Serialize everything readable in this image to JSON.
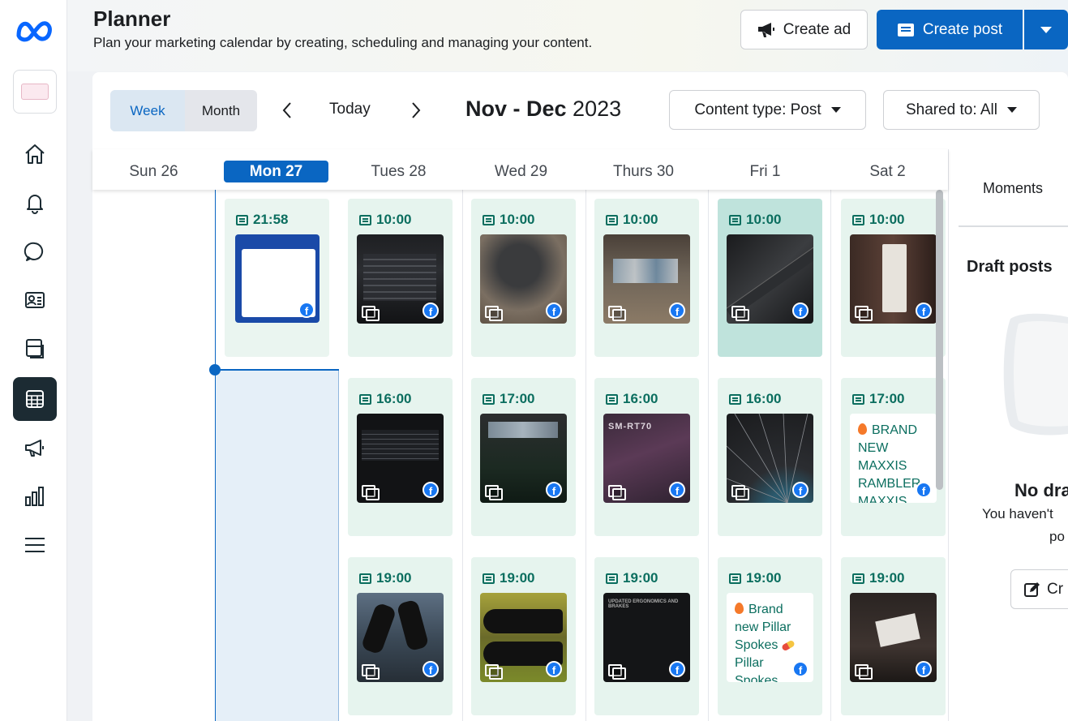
{
  "header": {
    "title": "Planner",
    "subtitle": "Plan your marketing calendar by creating, scheduling and managing your content.",
    "create_ad": "Create ad",
    "create_post": "Create post"
  },
  "toolbar": {
    "week": "Week",
    "month": "Month",
    "today": "Today",
    "range_bold": "Nov - Dec",
    "range_year": " 2023",
    "content_type": "Content type: Post",
    "shared_to": "Shared to: All"
  },
  "days": [
    "Sun 26",
    "Mon 27",
    "Tues 28",
    "Wed 29",
    "Thurs 30",
    "Fri 1",
    "Sat 2"
  ],
  "slots": {
    "mon_1": "21:58",
    "tue_1": "10:00",
    "wed_1": "10:00",
    "thu_1": "10:00",
    "fri_1": "10:00",
    "sat_1": "10:00",
    "tue_2": "16:00",
    "wed_2": "17:00",
    "thu_2": "16:00",
    "fri_2": "16:00",
    "sat_2": "17:00",
    "tue_3": "19:00",
    "wed_3": "19:00",
    "thu_3": "19:00",
    "fri_3": "19:00",
    "sat_3": "19:00"
  },
  "text_posts": {
    "sat_2": [
      "BRAND",
      "NEW",
      "MAXXIS",
      "RAMBLER",
      "MAXXIS"
    ],
    "fri_3": [
      "Brand",
      "new Pillar",
      "Spokes",
      "Pillar",
      "Spokes"
    ]
  },
  "right_panel": {
    "moments": "Moments",
    "drafts_title": "Draft posts",
    "empty_title": "No dra",
    "empty_text": "You haven't",
    "empty_text2": "po",
    "create_btn": "Cr"
  },
  "colors": {
    "primary": "#0a66c2",
    "slot_bg": "#e6f4ee",
    "time_text": "#0b6e5f"
  }
}
